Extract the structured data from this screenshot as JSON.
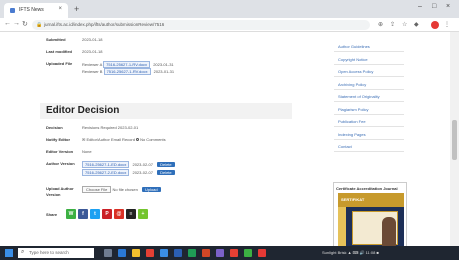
{
  "browser": {
    "tab_title": "IFTS News",
    "tab_close": "×",
    "new_tab": "+",
    "window_controls": [
      "–",
      "□",
      "×"
    ],
    "url": "jurnal.ifts.ac.id/index.php/ifts/author/submissionReview/7516",
    "nav": [
      "←",
      "→",
      "↻"
    ]
  },
  "submission_meta": [
    {
      "label": "Submitted",
      "value": "2023-01-18"
    },
    {
      "label": "Last modified",
      "value": "2023-01-18"
    },
    {
      "label": "Uploaded File",
      "value": ""
    }
  ],
  "uploaded_file": {
    "line1_prefix": "Reviewer A",
    "line1_chip": "7516-25627-1-RV.docx",
    "line1_date": "2023-01-31",
    "line2_prefix": "Reviewer B",
    "line2_chip": "7516-25627-1-RV.docx",
    "line2_date": "2023-01-31"
  },
  "editor_decision": {
    "heading": "Editor Decision",
    "decision_label": "Decision",
    "decision_value": "Revisions Required 2023-02-01",
    "notify_label": "Notify Editor",
    "notify_value": "Editor/Author Email Record",
    "notify_extra": "No Comments",
    "editor_version_label": "Editor Version",
    "editor_version_value": "None",
    "author_version_label": "Author Version",
    "author_version_rows": [
      {
        "chip": "7516-25627-1-ED.docx",
        "date": "2023-02-07",
        "button": "Delete"
      },
      {
        "chip": "7516-25627-2-ED.docx",
        "date": "2023-02-07",
        "button": "Delete"
      }
    ],
    "upload_label": "Upload Author Version",
    "choose_file": "Choose File",
    "no_file": "No file chosen",
    "upload_button": "Upload"
  },
  "share": {
    "label": "Share",
    "buttons": [
      {
        "name": "share-whatsapp",
        "color": "#3cb043",
        "glyph": "W"
      },
      {
        "name": "share-facebook",
        "color": "#3b5998",
        "glyph": "f"
      },
      {
        "name": "share-twitter",
        "color": "#1da1f2",
        "glyph": "t"
      },
      {
        "name": "share-pinterest",
        "color": "#cb2027",
        "glyph": "P"
      },
      {
        "name": "share-email",
        "color": "#d93025",
        "glyph": "@"
      },
      {
        "name": "share-print",
        "color": "#222222",
        "glyph": "≡"
      },
      {
        "name": "share-more",
        "color": "#74c52f",
        "glyph": "+"
      }
    ]
  },
  "sidebar": {
    "links": [
      "Author Guidelines",
      "Copyright Notice",
      "Open Access Policy",
      "Archiving Policy",
      "Statement of Originality",
      "Plagiarism Policy",
      "Publication Fee",
      "Indexing Pages",
      "Contact"
    ],
    "journal_title": "Certificate Accreditation Journal",
    "cover_text": "SERTIFIKAT"
  },
  "taskbar": {
    "search_placeholder": "Type here to search",
    "tray_text": "Sunlight Brisk   ▲ ⌨ 🔊  11:08  ■"
  },
  "colors": {
    "link": "#3a6db5",
    "chip_text": "#2a5db0",
    "primary_button": "#2f6fba",
    "taskbar": "#1f2631"
  }
}
